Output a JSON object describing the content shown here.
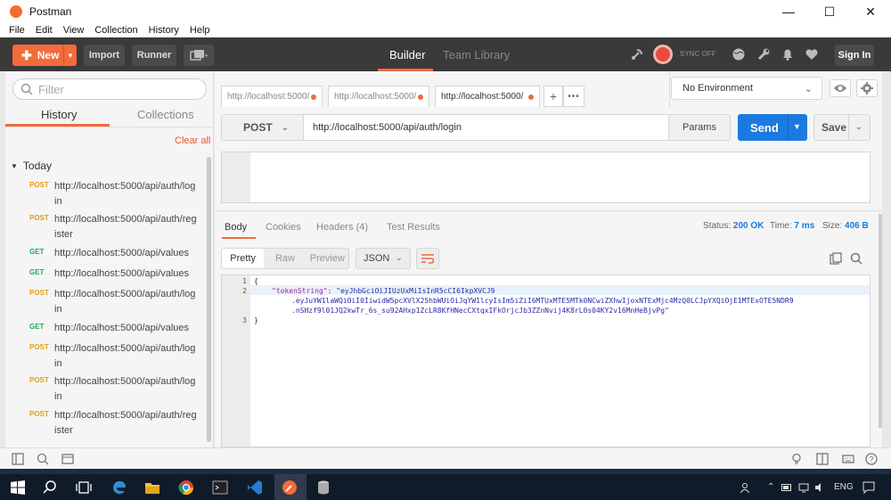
{
  "window": {
    "title": "Postman"
  },
  "menu": [
    "File",
    "Edit",
    "View",
    "Collection",
    "History",
    "Help"
  ],
  "toolbar": {
    "new_label": "New",
    "import_label": "Import",
    "runner_label": "Runner",
    "builder_tab": "Builder",
    "team_library_tab": "Team Library",
    "sync_label": "SYNC OFF",
    "sign_in_label": "Sign In"
  },
  "sidebar": {
    "filter_placeholder": "Filter",
    "tabs": [
      "History",
      "Collections"
    ],
    "clear_all": "Clear all",
    "group_label": "Today",
    "items": [
      {
        "method": "POST",
        "url": "http://localhost:5000/api/auth/login"
      },
      {
        "method": "POST",
        "url": "http://localhost:5000/api/auth/register"
      },
      {
        "method": "GET",
        "url": "http://localhost:5000/api/values"
      },
      {
        "method": "GET",
        "url": "http://localhost:5000/api/values"
      },
      {
        "method": "POST",
        "url": "http://localhost:5000/api/auth/login"
      },
      {
        "method": "GET",
        "url": "http://localhost:5000/api/values"
      },
      {
        "method": "POST",
        "url": "http://localhost:5000/api/auth/login"
      },
      {
        "method": "POST",
        "url": "http://localhost:5000/api/auth/login"
      },
      {
        "method": "POST",
        "url": "http://localhost:5000/api/auth/register"
      }
    ]
  },
  "request_tabs": [
    "http://localhost:5000/",
    "http://localhost:5000/",
    "http://localhost:5000/"
  ],
  "environment": {
    "selected": "No Environment"
  },
  "request": {
    "method": "POST",
    "url": "http://localhost:5000/api/auth/login",
    "params_label": "Params",
    "send_label": "Send",
    "save_label": "Save"
  },
  "response": {
    "tabs": [
      "Body",
      "Cookies",
      "Headers (4)",
      "Test Results"
    ],
    "status_label": "Status:",
    "status_value": "200 OK",
    "time_label": "Time:",
    "time_value": "7 ms",
    "size_label": "Size:",
    "size_value": "406 B",
    "view_modes": [
      "Pretty",
      "Raw",
      "Preview"
    ],
    "format": "JSON",
    "line_numbers": [
      "1",
      "2",
      "3"
    ],
    "code": {
      "open_brace": "{",
      "key": "\"tokenString\"",
      "colon": ": ",
      "value_line1": "\"eyJhbGciOiJIUzUxMiIsInR5cCI6IkpXVCJ9",
      "value_line2": ".eyJuYW1laWQiOiI0IiwidW5pcXVlX25hbWUiOiJqYW1lcyIsIm5iZiI6MTUxMTE5MTk0NCwiZXhwIjoxNTExMjc4MzQ0LCJpYXQiOjE1MTExOTE5NDR9",
      "value_line3": ".nSHzf9l01JQ2kwTr_6s_su92AHxp1ZcLR8KfHNecCXtqxIFkOrjcJb3ZZnNvij4K8rL0s04KY2v16MnHeBjvPg\"",
      "close_brace": "}"
    }
  },
  "taskbar": {
    "lang": "ENG"
  },
  "colors": {
    "accent": "#f26b3a",
    "send": "#1b7ae0",
    "toolbar_bg": "#3a3a3a",
    "post": "#e79e13",
    "get": "#25a85b"
  }
}
